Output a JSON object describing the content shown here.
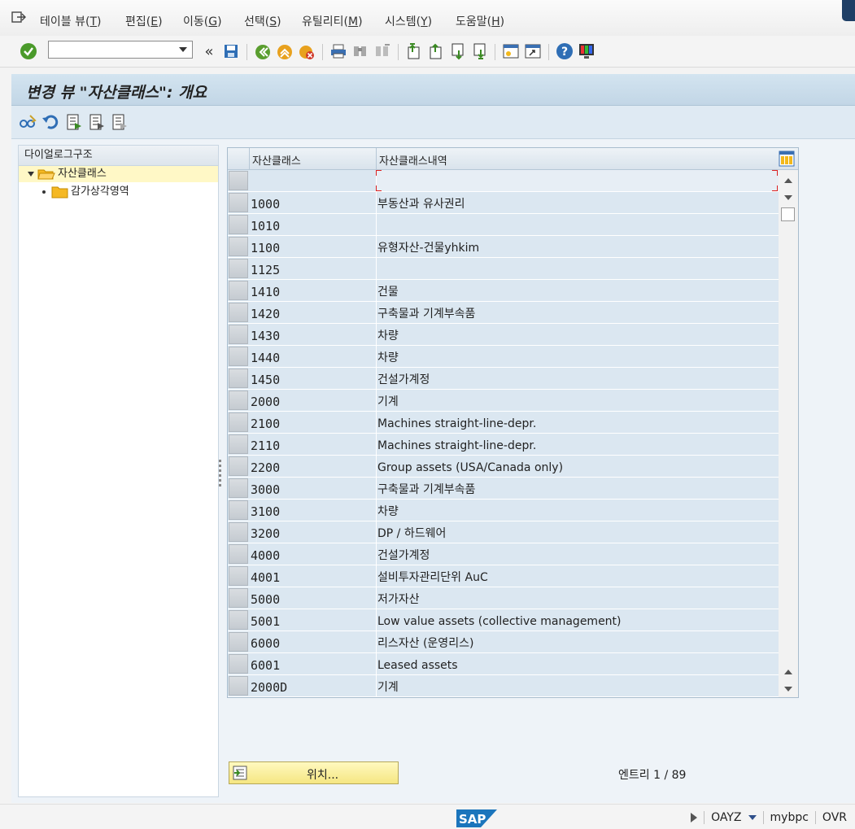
{
  "menu": {
    "items": [
      {
        "label": "테이블 뷰",
        "key": "T"
      },
      {
        "label": "편집",
        "key": "E"
      },
      {
        "label": "이동",
        "key": "G"
      },
      {
        "label": "선택",
        "key": "S"
      },
      {
        "label": "유틸리티",
        "key": "M"
      },
      {
        "label": "시스템",
        "key": "Y"
      },
      {
        "label": "도움말",
        "key": "H"
      }
    ]
  },
  "toolbar": {
    "command_value": "",
    "nav_back_glyph": "«"
  },
  "title": "변경 뷰 \"자산클래스\": 개요",
  "tree": {
    "header": "다이얼로그구조",
    "nodes": [
      {
        "label": "자산클래스"
      },
      {
        "label": "감가상각영역"
      }
    ]
  },
  "table": {
    "columns": [
      "자산클래스",
      "자산클래스내역"
    ],
    "rows": [
      [
        "",
        ""
      ],
      [
        "1000",
        "부동산과 유사권리"
      ],
      [
        "1010",
        ""
      ],
      [
        "1100",
        "유형자산-건물yhkim"
      ],
      [
        "1125",
        ""
      ],
      [
        "1410",
        "건물"
      ],
      [
        "1420",
        "구축물과 기계부속품"
      ],
      [
        "1430",
        "차량"
      ],
      [
        "1440",
        "차량"
      ],
      [
        "1450",
        "건설가계정"
      ],
      [
        "2000",
        "기계"
      ],
      [
        "2100",
        "Machines straight-line-depr."
      ],
      [
        "2110",
        "Machines straight-line-depr."
      ],
      [
        "2200",
        "Group assets (USA/Canada only)"
      ],
      [
        "3000",
        "구축물과 기계부속품"
      ],
      [
        "3100",
        "차량"
      ],
      [
        "3200",
        "DP / 하드웨어"
      ],
      [
        "4000",
        "건설가계정"
      ],
      [
        "4001",
        "설비투자관리단위 AuC"
      ],
      [
        "5000",
        "저가자산"
      ],
      [
        "5001",
        "Low value assets (collective management)"
      ],
      [
        "6000",
        "리스자산 (운영리스)"
      ],
      [
        "6001",
        "Leased assets"
      ],
      [
        "2000D",
        "기계"
      ]
    ]
  },
  "position_button": "위치...",
  "entries": "엔트리 1 / 89",
  "status": {
    "logo": "SAP",
    "system": "OAYZ",
    "client": "mybpc",
    "mode": "OVR"
  }
}
